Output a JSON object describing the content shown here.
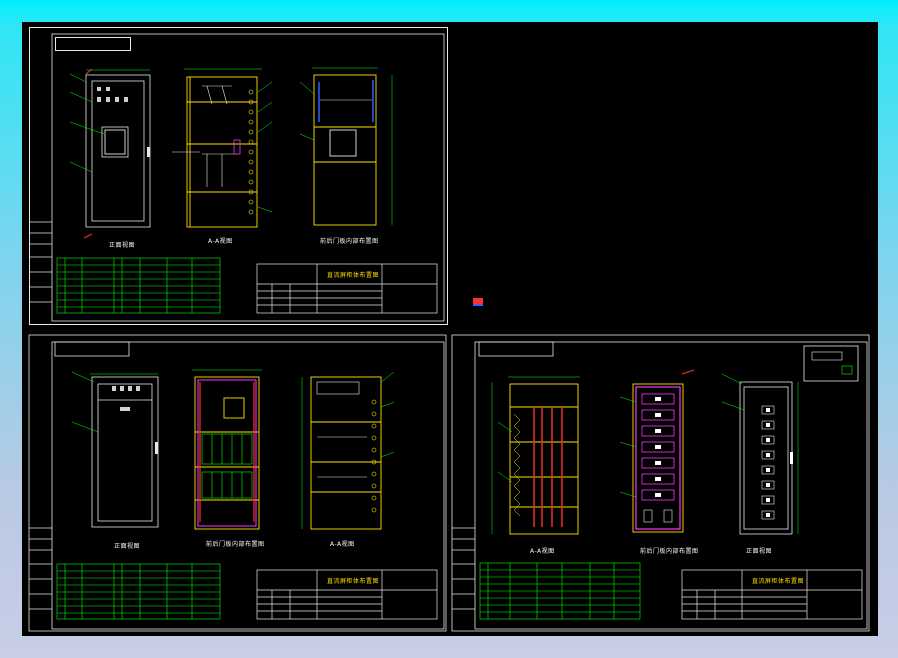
{
  "drawings": {
    "sheet1": {
      "view_labels": [
        "正面视图",
        "A-A视图",
        "前后门板内部布置图"
      ]
    },
    "sheet2": {
      "view_labels": [
        "正面视图",
        "前后门板内部布置图",
        "A-A视图"
      ]
    },
    "sheet3": {
      "view_labels": [
        "A-A视图",
        "前后门板内部布置图",
        "正面视图"
      ]
    },
    "title_block_name": "直流屏柜体布置图"
  },
  "colors": {
    "cabinet_outline": "#ffe000",
    "frame": "#e8e8e8",
    "dimension": "#00ff00",
    "accent_magenta": "#ff33ff",
    "accent_red": "#ff3030",
    "accent_blue": "#3060ff",
    "background": "#000000"
  }
}
